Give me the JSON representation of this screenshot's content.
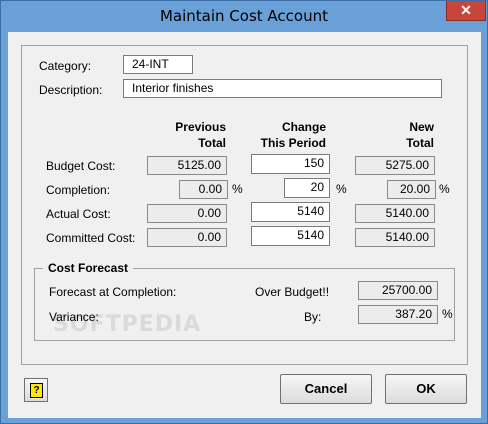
{
  "window": {
    "title": "Maintain Cost Account",
    "close_label": "✕"
  },
  "category": {
    "label": "Category:",
    "value": "24-INT"
  },
  "description": {
    "label": "Description:",
    "value": "Interior finishes"
  },
  "headers": {
    "previous": "Previous\nTotal",
    "change": "Change\nThis Period",
    "new": "New\nTotal"
  },
  "rows": [
    {
      "label": "Budget Cost:",
      "previous": "5125.00",
      "change": "150",
      "new": "5275.00",
      "pct": false
    },
    {
      "label": "Completion:",
      "previous": "0.00",
      "change": "20",
      "new": "20.00",
      "pct": true
    },
    {
      "label": "Actual Cost:",
      "previous": "0.00",
      "change": "5140",
      "new": "5140.00",
      "pct": false
    },
    {
      "label": "Committed Cost:",
      "previous": "0.00",
      "change": "5140",
      "new": "5140.00",
      "pct": false
    }
  ],
  "pct_symbol": "%",
  "forecast": {
    "title": "Cost Forecast",
    "fac_label": "Forecast at Completion:",
    "status_label": "Over Budget!!",
    "fac_value": "25700.00",
    "variance_label": "Variance:",
    "by_label": "By:",
    "variance_value": "387.20"
  },
  "watermark": "SOFTPEDIA",
  "buttons": {
    "cancel": "Cancel",
    "ok": "OK",
    "help": "?"
  }
}
